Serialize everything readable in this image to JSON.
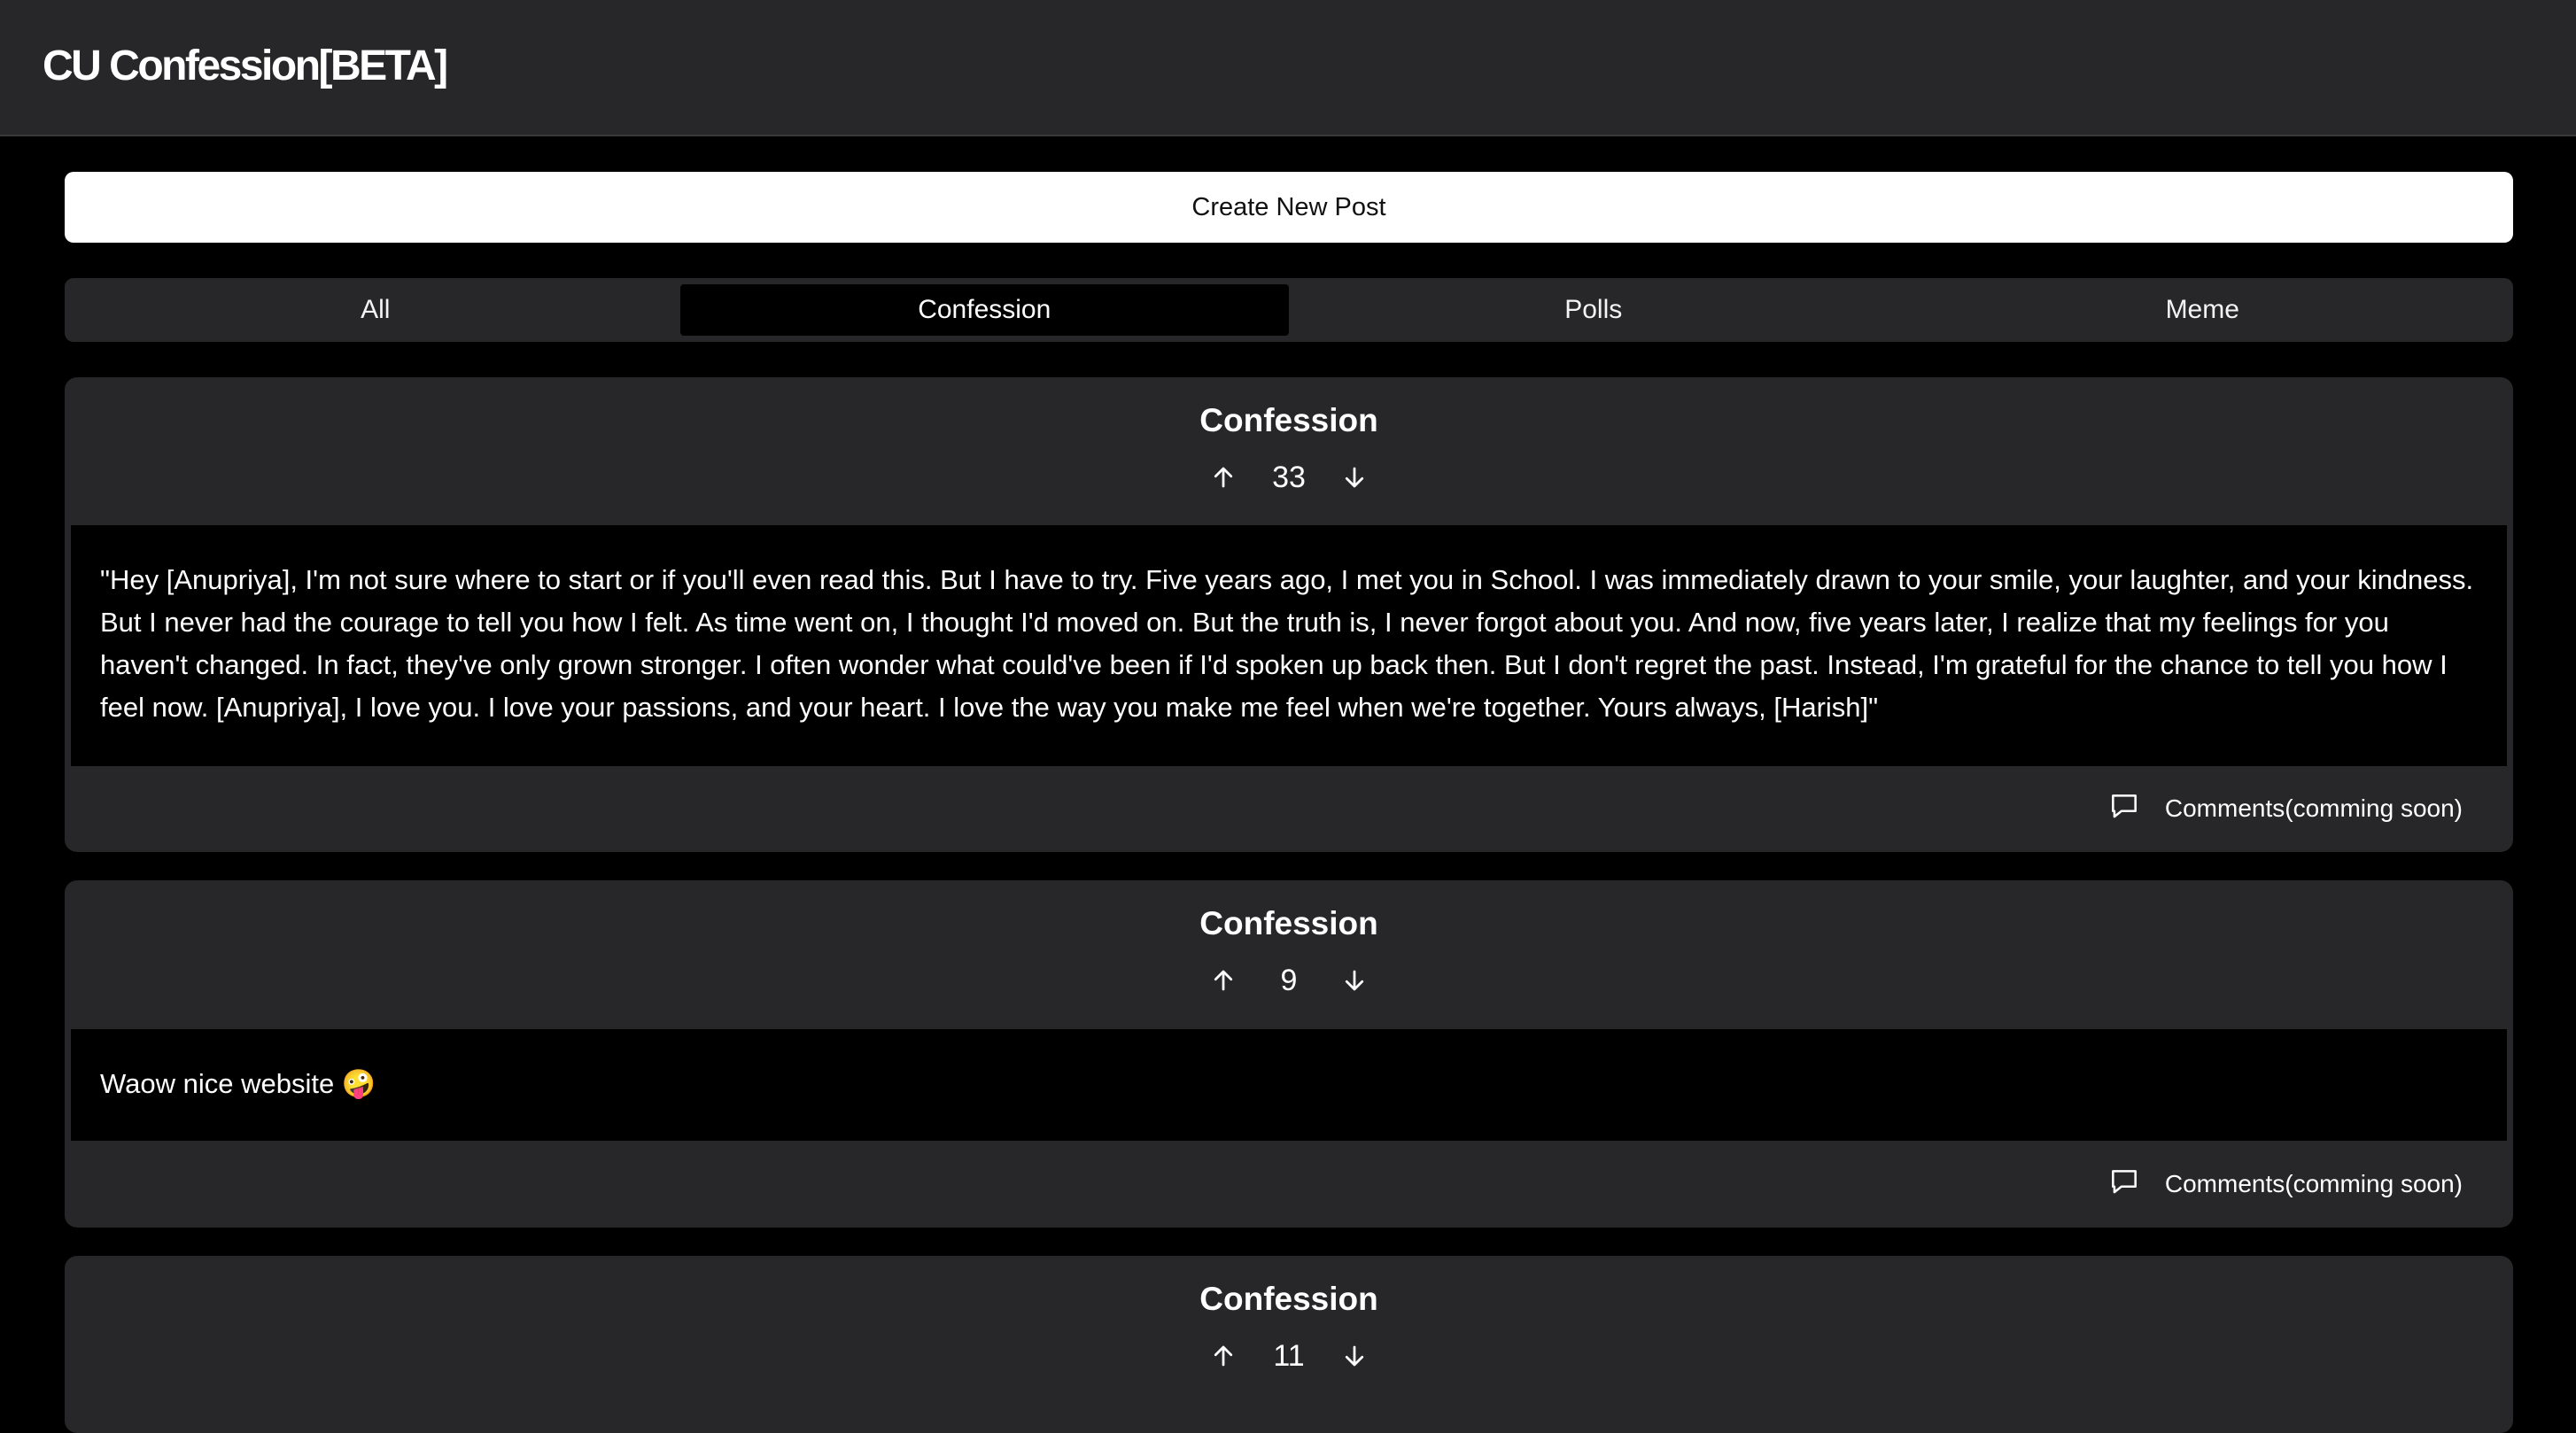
{
  "header": {
    "title": "CU Confession[BETA]"
  },
  "create_button": {
    "label": "Create New Post"
  },
  "tabs": [
    {
      "label": "All",
      "active": false
    },
    {
      "label": "Confession",
      "active": true
    },
    {
      "label": "Polls",
      "active": false
    },
    {
      "label": "Meme",
      "active": false
    }
  ],
  "posts": [
    {
      "type": "Confession",
      "votes": "33",
      "body": "\"Hey [Anupriya], I'm not sure where to start or if you'll even read this. But I have to try. Five years ago, I met you in School. I was immediately drawn to your smile, your laughter, and your kindness. But I never had the courage to tell you how I felt. As time went on, I thought I'd moved on. But the truth is, I never forgot about you. And now, five years later, I realize that my feelings for you haven't changed. In fact, they've only grown stronger. I often wonder what could've been if I'd spoken up back then. But I don't regret the past. Instead, I'm grateful for the chance to tell you how I feel now. [Anupriya], I love you. I love your passions, and your heart. I love the way you make me feel when we're together. Yours always, [Harish]\"",
      "comments_label": "Comments(comming soon)"
    },
    {
      "type": "Confession",
      "votes": "9",
      "body": "Waow nice website 🤪",
      "comments_label": "Comments(comming soon)"
    },
    {
      "type": "Confession",
      "votes": "11"
    }
  ],
  "icons": {
    "upvote": "arrow-up-icon",
    "downvote": "arrow-down-icon",
    "comment": "comment-bubble-icon"
  },
  "colors": {
    "background": "#000000",
    "surface": "#27272a",
    "primary_button": "#ffffff",
    "text": "#ffffff"
  }
}
